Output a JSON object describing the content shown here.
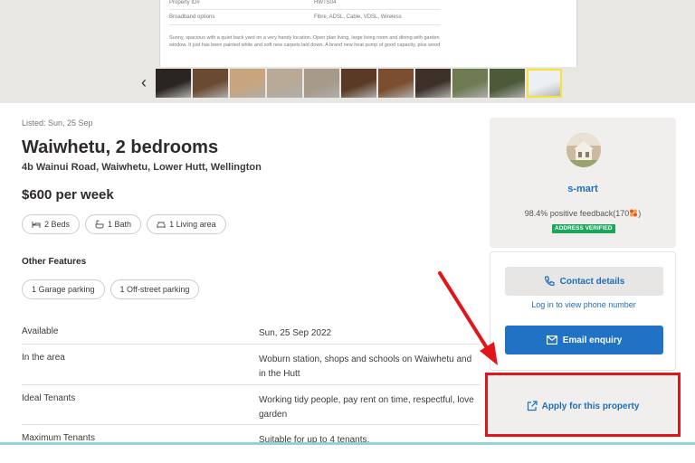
{
  "gallery": {
    "doc_rows": [
      {
        "label": "Property ID#",
        "value": "HWTS04"
      },
      {
        "label": "Broadband options",
        "value": "Fibre, ADSL, Cable, VDSL, Wireless"
      }
    ],
    "doc_text": "Sunny, spacious with a quiet back yard on a very handy location.  Open plan living, large living room and dining with garden window. It just has been painted white and soft new carpets laid down. A brand new heat pump of good capacity, plus wood",
    "prev_arrow": "‹",
    "thumb_colors": [
      "#2a2522",
      "#6b4a32",
      "#c9a57f",
      "#b8aa97",
      "#a69a88",
      "#5a3a24",
      "#7a4e2e",
      "#3c3028",
      "#6e7a52",
      "#4c5a3a",
      "#edf0f2"
    ]
  },
  "listing": {
    "listed": "Listed: Sun, 25 Sep",
    "title": "Waiwhetu, 2 bedrooms",
    "address": "4b Wainui Road, Waiwhetu, Lower Hutt, Wellington",
    "price": "$600 per week",
    "attributes": [
      "2 Beds",
      "1 Bath",
      "1 Living area"
    ],
    "other_features_heading": "Other Features",
    "features": [
      "1 Garage parking",
      "1 Off-street parking"
    ],
    "details": [
      {
        "label": "Available",
        "value": "Sun, 25 Sep 2022"
      },
      {
        "label": "In the area",
        "value": "Woburn station, shops and schools on Waiwhetu and in the Hutt"
      },
      {
        "label": "Ideal Tenants",
        "value": "Working tidy people, pay rent on time, respectful, love garden"
      },
      {
        "label": "Maximum Tenants",
        "value": "Suitable for up to 4 tenants."
      }
    ]
  },
  "seller": {
    "name": "s-mart",
    "feedback_prefix": "98.4% positive feedback(",
    "feedback_count": "170",
    "feedback_suffix": ")",
    "verified": "ADDRESS VERIFIED"
  },
  "contact": {
    "contact_label": "Contact details",
    "phone_link": "Log in to view phone number",
    "email_label": "Email enquiry"
  },
  "apply": {
    "label": "Apply for this property"
  },
  "colors": {
    "link_blue": "#1f6fb5",
    "primary_button": "#1f72c4",
    "verified_green": "#1aa55a",
    "annotation_red": "#e0161b"
  }
}
